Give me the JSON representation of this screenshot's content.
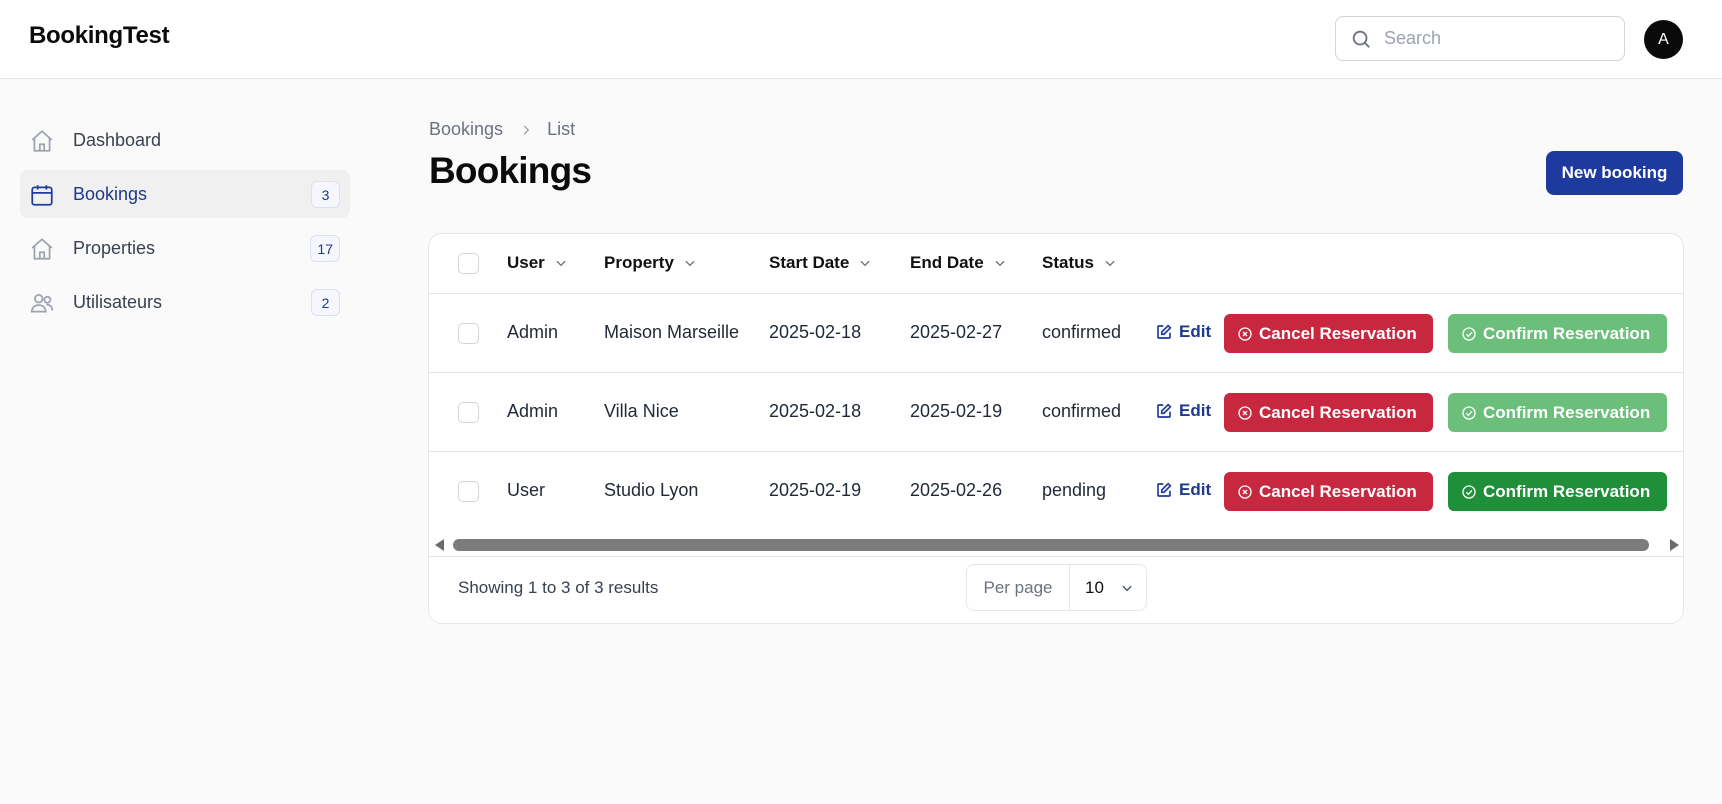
{
  "app": {
    "title": "BookingTest"
  },
  "header": {
    "search_placeholder": "Search",
    "avatar_initial": "A"
  },
  "sidebar": {
    "items": [
      {
        "label": "Dashboard",
        "icon": "home-icon",
        "badge": "",
        "active": false
      },
      {
        "label": "Bookings",
        "icon": "calendar-icon",
        "badge": "3",
        "active": true
      },
      {
        "label": "Properties",
        "icon": "home-icon",
        "badge": "17",
        "active": false
      },
      {
        "label": "Utilisateurs",
        "icon": "users-icon",
        "badge": "2",
        "active": false
      }
    ]
  },
  "breadcrumb": {
    "parent": "Bookings",
    "current": "List"
  },
  "page": {
    "title": "Bookings",
    "new_button": "New booking"
  },
  "table": {
    "columns": [
      "User",
      "Property",
      "Start Date",
      "End Date",
      "Status"
    ],
    "rows": [
      {
        "user": "Admin",
        "property": "Maison Marseille",
        "start": "2025-02-18",
        "end": "2025-02-27",
        "status": "confirmed",
        "confirm_enabled": false
      },
      {
        "user": "Admin",
        "property": "Villa Nice",
        "start": "2025-02-18",
        "end": "2025-02-19",
        "status": "confirmed",
        "confirm_enabled": false
      },
      {
        "user": "User",
        "property": "Studio Lyon",
        "start": "2025-02-19",
        "end": "2025-02-26",
        "status": "pending",
        "confirm_enabled": true
      }
    ],
    "actions": {
      "edit": "Edit",
      "cancel": "Cancel Reservation",
      "confirm": "Confirm Reservation"
    }
  },
  "footer": {
    "results_text": "Showing 1 to 3 of 3 results",
    "per_page_label": "Per page",
    "per_page_value": "10"
  },
  "colors": {
    "primary": "#1e3a9e",
    "danger": "#c8283f",
    "success": "#1f8f3a",
    "success_disabled": "#6bbf7a"
  }
}
